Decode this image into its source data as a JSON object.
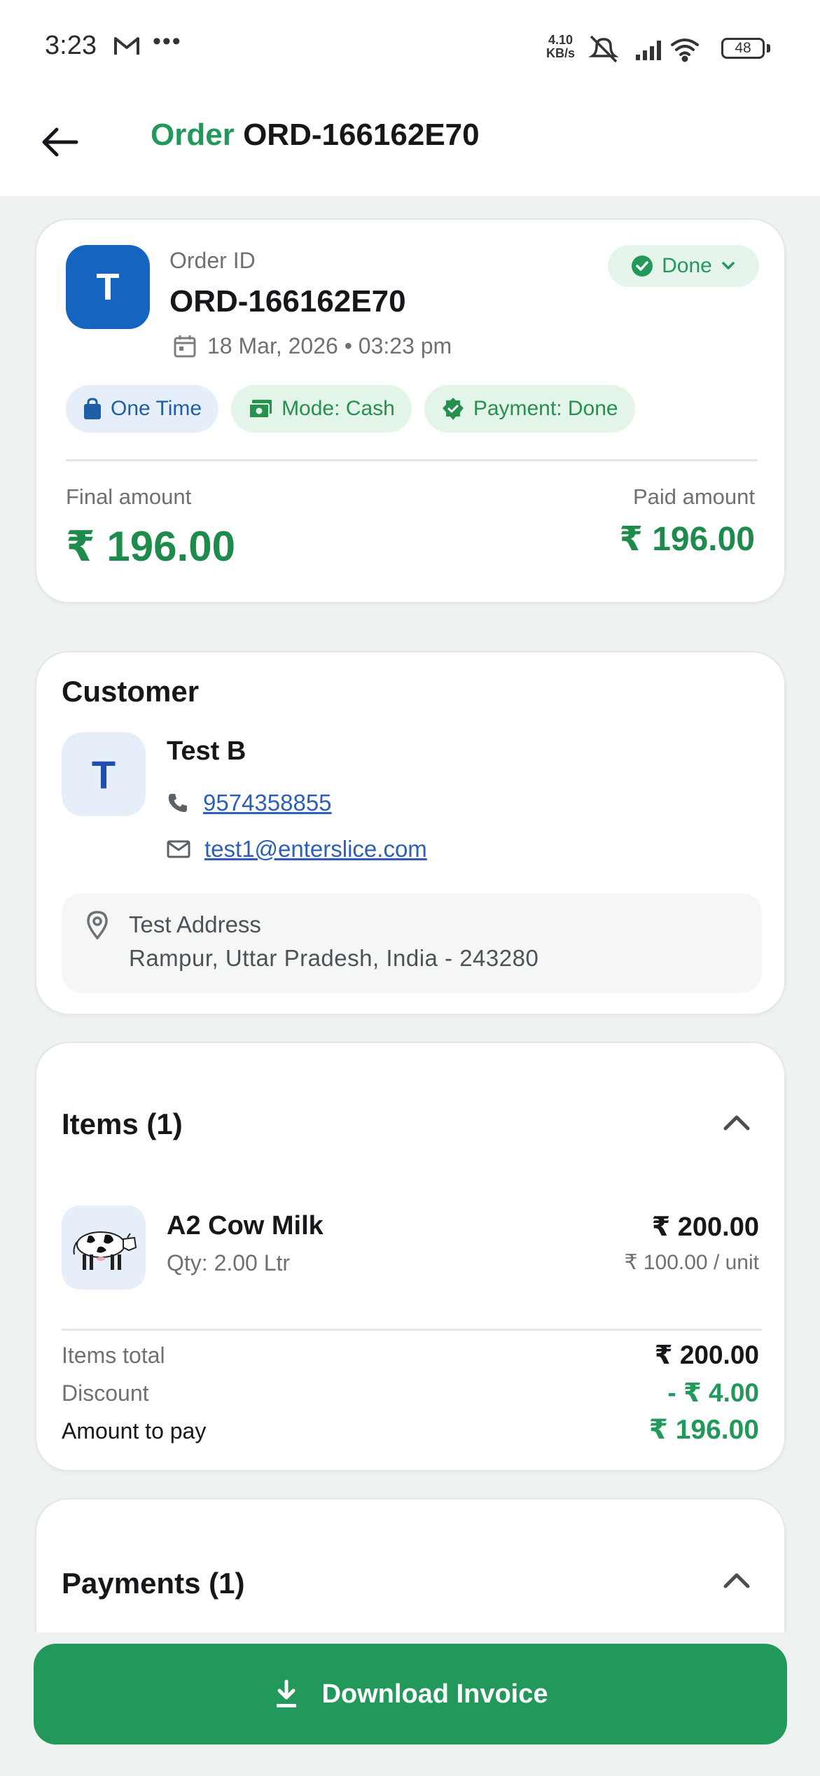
{
  "status_bar": {
    "time": "3:23",
    "dots": "•••",
    "net_speed_value": "4.10",
    "net_speed_unit": "KB/s",
    "battery": "48"
  },
  "app_bar": {
    "title_prefix": "Order",
    "title_id": "ORD-166162E70"
  },
  "order": {
    "avatar_letter": "T",
    "id_label": "Order ID",
    "id_value": "ORD-166162E70",
    "date": "18 Mar, 2026 • 03:23 pm",
    "status": "Done",
    "chips": {
      "type": "One Time",
      "mode": "Mode: Cash",
      "payment": "Payment: Done"
    },
    "final_label": "Final amount",
    "final_value": "₹ 196.00",
    "paid_label": "Paid amount",
    "paid_value": "₹ 196.00"
  },
  "customer": {
    "section_title": "Customer",
    "avatar_letter": "T",
    "name": "Test B",
    "phone": "9574358855",
    "email": "test1@enterslice.com",
    "address_line1": "Test Address",
    "address_line2": "Rampur, Uttar Pradesh, India - 243280"
  },
  "items": {
    "section_title": "Items (1)",
    "list": [
      {
        "name": "A2 Cow Milk",
        "qty": "Qty: 2.00 Ltr",
        "price": "₹ 200.00",
        "unit_price": "₹ 100.00 / unit"
      }
    ],
    "summary": {
      "items_total_label": "Items total",
      "items_total_value": "₹ 200.00",
      "discount_label": "Discount",
      "discount_value": "- ₹ 4.00",
      "pay_label": "Amount to pay",
      "pay_value": "₹ 196.00"
    }
  },
  "payments": {
    "section_title": "Payments (1)"
  },
  "footer": {
    "download_label": "Download Invoice"
  },
  "colors": {
    "accent_green": "#22995a",
    "avatar_blue": "#1565c0",
    "link_blue": "#2c5fb8"
  }
}
